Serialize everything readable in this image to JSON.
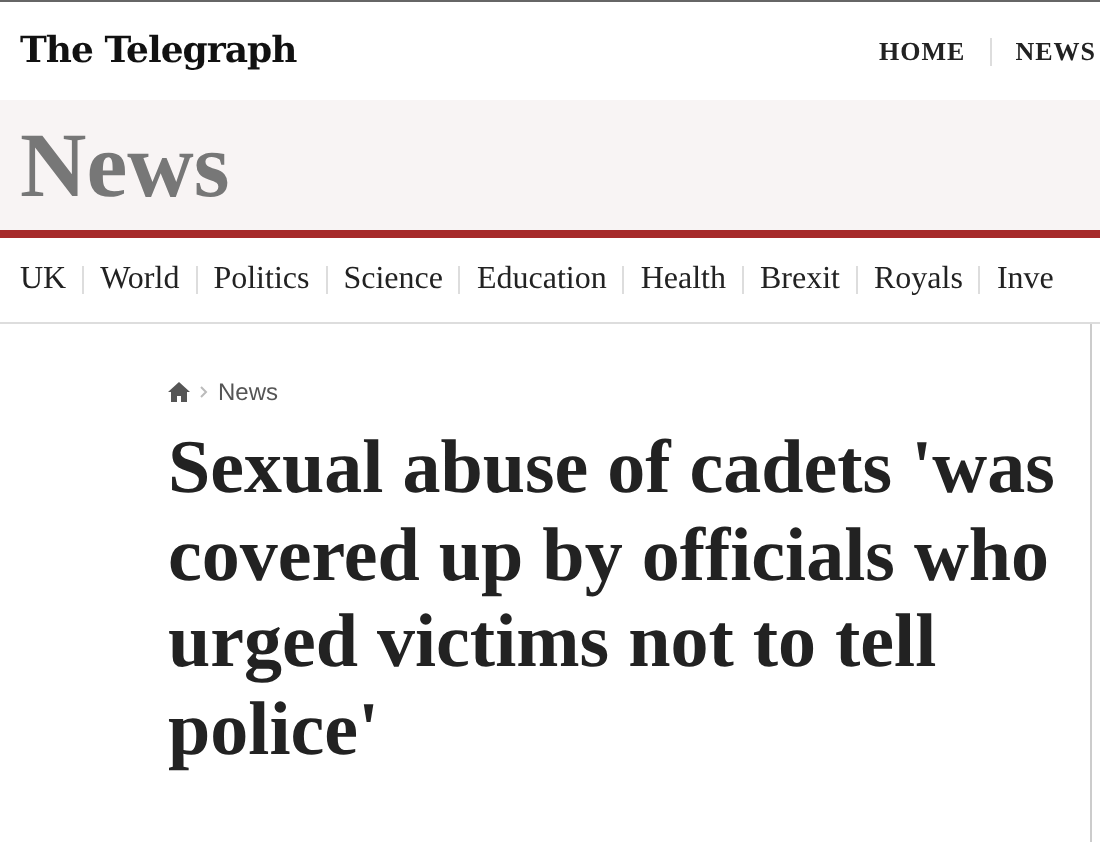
{
  "masthead": {
    "logo": "The Telegraph",
    "top_links": [
      "HOME",
      "NEWS"
    ]
  },
  "section": {
    "title": "News"
  },
  "nav": [
    "UK",
    "World",
    "Politics",
    "Science",
    "Education",
    "Health",
    "Brexit",
    "Royals",
    "Inve"
  ],
  "breadcrumb": {
    "label": "News"
  },
  "headline": "Sexual abuse of cadets 'was covered up by officials who urged victims not to tell police'"
}
